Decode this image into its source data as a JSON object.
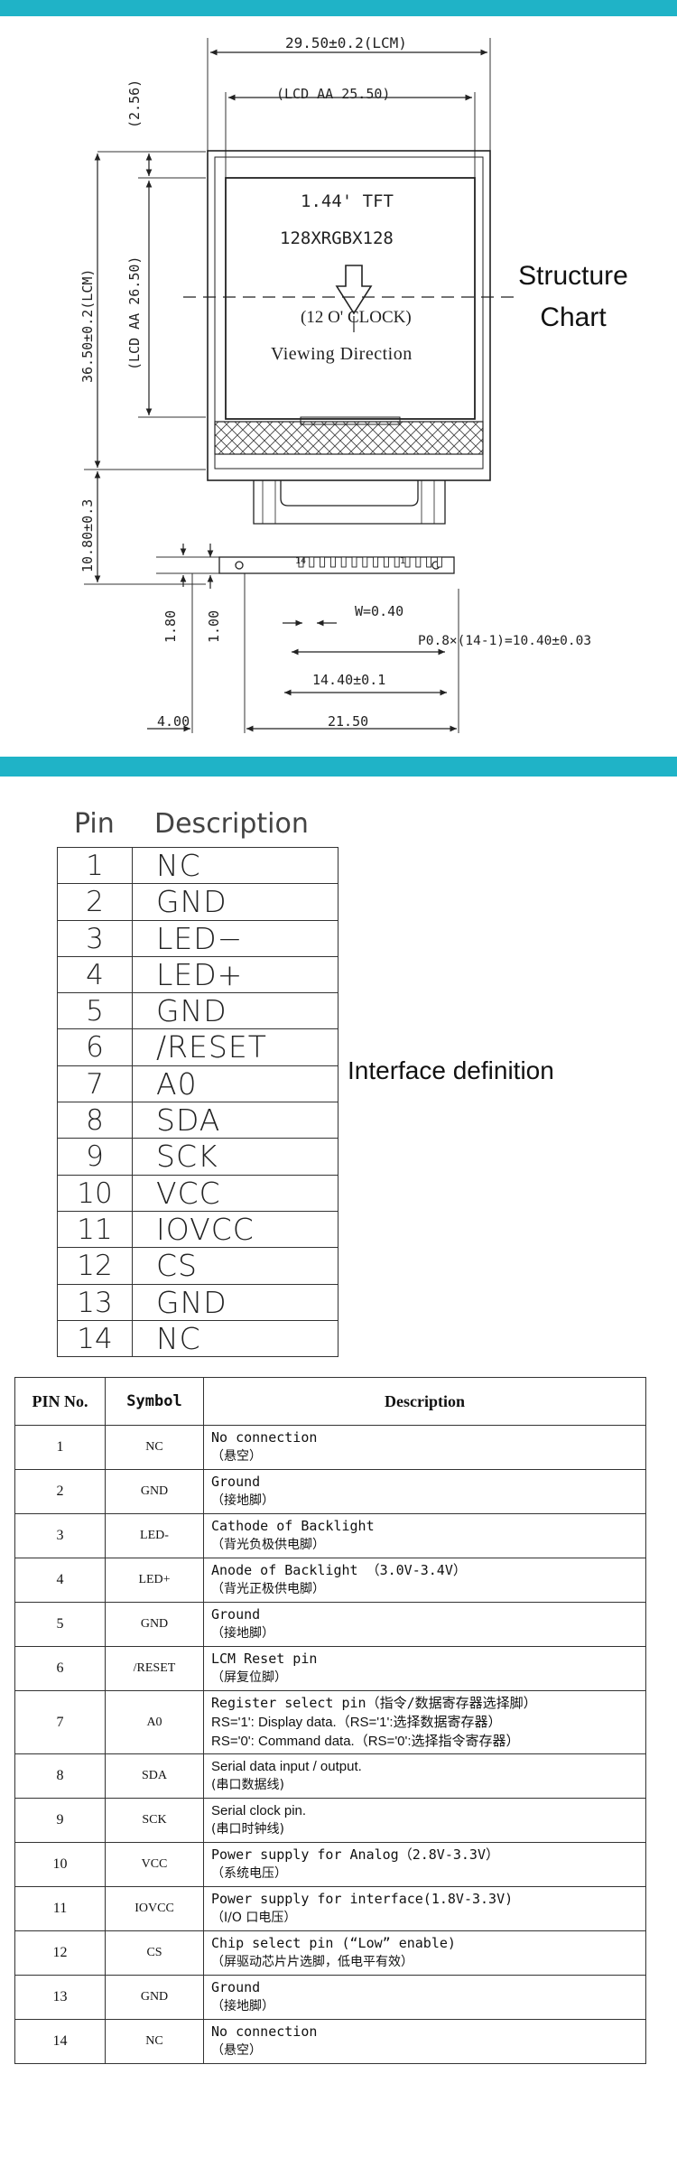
{
  "structure": {
    "caption_line1": "Structure",
    "caption_line2": "Chart",
    "dimensions": {
      "width_lcm": "29.50±0.2(LCM)",
      "lcd_aa_width": "(LCD AA 25.50)",
      "top_margin": "(2.56)",
      "height_lcm": "36.50±0.2(LCM)",
      "lcd_aa_height": "(LCD AA 26.50)",
      "fpc_length": "10.80±0.3",
      "pin_hole": "1.80",
      "pin_offset": "1.00",
      "pin_width": "W=0.40",
      "pin_pitch": "P0.8×(14-1)=10.40±0.03",
      "pin_span": "14.40±0.1",
      "left_offset": "4.00",
      "base_width": "21.50",
      "pin_first": "14",
      "pin_last": "1"
    },
    "screen": {
      "size": "1.44' TFT",
      "resolution": "128XRGBX128",
      "clock": "(12 O' CLOCK)",
      "viewing": "Viewing Direction"
    }
  },
  "interface": {
    "caption": "Interface definition",
    "header_pin": "Pin",
    "header_desc": "Description",
    "rows": [
      {
        "pin": "1",
        "desc": "NC"
      },
      {
        "pin": "2",
        "desc": "GND"
      },
      {
        "pin": "3",
        "desc": "LED−"
      },
      {
        "pin": "4",
        "desc": "LED+"
      },
      {
        "pin": "5",
        "desc": "GND"
      },
      {
        "pin": "6",
        "desc": "/RESET"
      },
      {
        "pin": "7",
        "desc": "A0"
      },
      {
        "pin": "8",
        "desc": "SDA"
      },
      {
        "pin": "9",
        "desc": "SCK"
      },
      {
        "pin": "10",
        "desc": "VCC"
      },
      {
        "pin": "11",
        "desc": "IOVCC"
      },
      {
        "pin": "12",
        "desc": "CS"
      },
      {
        "pin": "13",
        "desc": "GND"
      },
      {
        "pin": "14",
        "desc": "NC"
      }
    ]
  },
  "pin_table": {
    "headers": {
      "no": "PIN No.",
      "symbol": "Symbol",
      "description": "Description"
    },
    "rows": [
      {
        "no": "1",
        "symbol": "NC",
        "lines": [
          {
            "t": "No connection",
            "s": "mono"
          },
          {
            "t": "（悬空）",
            "s": "cn"
          }
        ]
      },
      {
        "no": "2",
        "symbol": "GND",
        "lines": [
          {
            "t": "Ground",
            "s": "mono"
          },
          {
            "t": "（接地脚）",
            "s": "cn"
          }
        ]
      },
      {
        "no": "3",
        "symbol": "LED-",
        "lines": [
          {
            "t": "Cathode of Backlight",
            "s": "mono"
          },
          {
            "t": "（背光负极供电脚）",
            "s": "cn"
          }
        ]
      },
      {
        "no": "4",
        "symbol": "LED+",
        "lines": [
          {
            "t": "Anode of Backlight （3.0V-3.4V）",
            "s": "mono"
          },
          {
            "t": "（背光正极供电脚）",
            "s": "cn"
          }
        ]
      },
      {
        "no": "5",
        "symbol": "GND",
        "lines": [
          {
            "t": "Ground",
            "s": "mono"
          },
          {
            "t": "（接地脚）",
            "s": "cn"
          }
        ]
      },
      {
        "no": "6",
        "symbol": "/RESET",
        "lines": [
          {
            "t": "LCM Reset pin",
            "s": "mono"
          },
          {
            "t": "（屏复位脚）",
            "s": "cn"
          }
        ]
      },
      {
        "no": "7",
        "symbol": "A0",
        "lines": [
          {
            "t": "Register select pin（指令/数据寄存器选择脚）",
            "s": "mono"
          },
          {
            "t": "RS='1': Display data.（RS='1':选择数据寄存器）",
            "s": "sans"
          },
          {
            "t": "RS='0': Command data.（RS='0':选择指令寄存器）",
            "s": "sans"
          }
        ]
      },
      {
        "no": "8",
        "symbol": "SDA",
        "lines": [
          {
            "t": "Serial data input / output.",
            "s": "sans"
          },
          {
            "t": "(串口数据线)",
            "s": "cn"
          }
        ]
      },
      {
        "no": "9",
        "symbol": "SCK",
        "lines": [
          {
            "t": "Serial clock pin.",
            "s": "sans"
          },
          {
            "t": "(串口时钟线)",
            "s": "cn"
          }
        ]
      },
      {
        "no": "10",
        "symbol": "VCC",
        "lines": [
          {
            "t": "Power supply for Analog（2.8V-3.3V）",
            "s": "mono"
          },
          {
            "t": "（系统电压）",
            "s": "cn"
          }
        ]
      },
      {
        "no": "11",
        "symbol": "IOVCC",
        "lines": [
          {
            "t": "Power supply for interface(1.8V-3.3V)",
            "s": "mono"
          },
          {
            "t": "（I/O 口电压）",
            "s": "cn"
          }
        ]
      },
      {
        "no": "12",
        "symbol": "CS",
        "lines": [
          {
            "t": "Chip select pin (“Low” enable)",
            "s": "mono"
          },
          {
            "t": "（屏驱动芯片片选脚，低电平有效）",
            "s": "cn"
          }
        ]
      },
      {
        "no": "13",
        "symbol": "GND",
        "lines": [
          {
            "t": "Ground",
            "s": "mono"
          },
          {
            "t": "（接地脚）",
            "s": "cn"
          }
        ]
      },
      {
        "no": "14",
        "symbol": "NC",
        "lines": [
          {
            "t": "No connection",
            "s": "mono"
          },
          {
            "t": "（悬空）",
            "s": "cn"
          }
        ]
      }
    ]
  }
}
